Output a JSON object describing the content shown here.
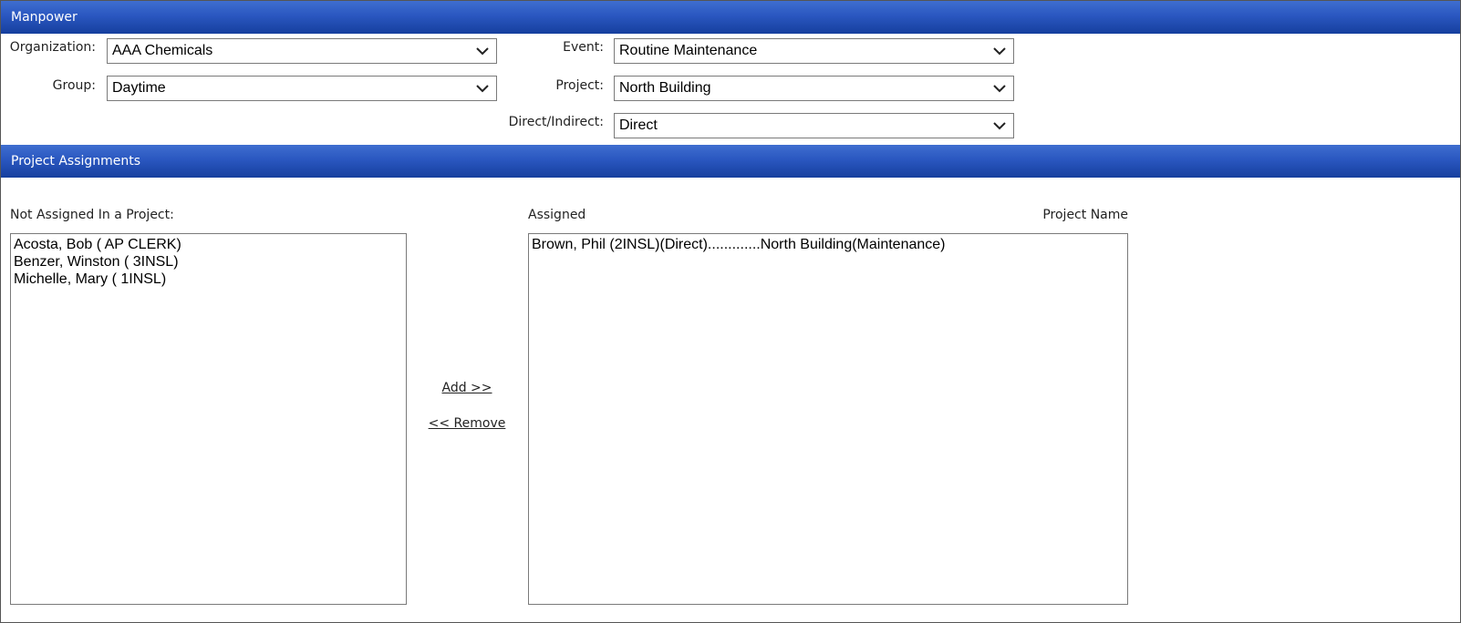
{
  "manpower": {
    "title": "Manpower",
    "organization": {
      "label": "Organization:",
      "value": "AAA Chemicals"
    },
    "group": {
      "label": "Group:",
      "value": "Daytime"
    },
    "event": {
      "label": "Event:",
      "value": "Routine Maintenance"
    },
    "project": {
      "label": "Project:",
      "value": "North Building"
    },
    "direct_indirect": {
      "label": "Direct/Indirect:",
      "value": "Direct"
    }
  },
  "assignments": {
    "title": "Project Assignments",
    "not_assigned_label": "Not Assigned In a Project:",
    "assigned_label": "Assigned",
    "project_name_label": "Project Name",
    "not_assigned_items": [
      "Acosta, Bob ( AP CLERK)",
      "Benzer, Winston ( 3INSL)",
      "Michelle, Mary ( 1INSL)"
    ],
    "assigned_items": [
      "Brown, Phil (2INSL)(Direct).............North Building(Maintenance)"
    ],
    "add_label": "Add >>",
    "remove_label": "<< Remove"
  }
}
